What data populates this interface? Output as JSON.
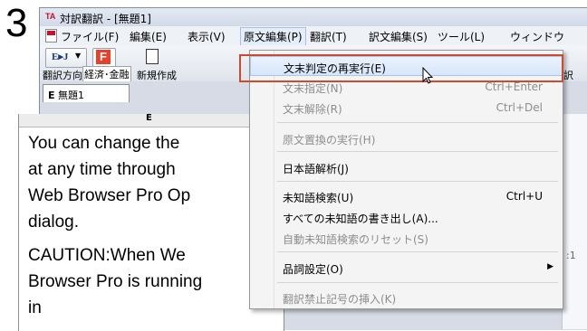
{
  "step_number": "3",
  "window": {
    "title": "対訳翻訳 - [無題1]",
    "app_icon": "TA"
  },
  "menubar": {
    "items": [
      "ファイル(F)",
      "編集(E)",
      "表示(V)",
      "原文編集(P)",
      "翻訳(T)",
      "訳文編集(S)",
      "ツール(L)",
      "ウィンドウ"
    ],
    "active": "原文編集(P)"
  },
  "toolbar": {
    "direction_icon_text": "E▸J",
    "direction_label": "翻訳方向",
    "field_icon_text": "F",
    "field_label": "経済･金融",
    "new_label": "新規作成",
    "right_label": "訳"
  },
  "tab": {
    "label": "無題1",
    "prefix": "E"
  },
  "panel": {
    "header": "E",
    "paragraph1": [
      "You can change the",
      "at any time through",
      "Web Browser Pro Op",
      "dialog."
    ],
    "paragraph2": [
      "CAUTION:When We",
      "Browser Pro is running in"
    ]
  },
  "right_marker": ":1",
  "dropdown": {
    "items": [
      {
        "label": "文末判定の再実行(E)",
        "shortcut": "",
        "disabled": false,
        "highlighted": true
      },
      {
        "label": "文末指定(N)",
        "shortcut": "Ctrl+Enter",
        "disabled": true
      },
      {
        "label": "文末解除(R)",
        "shortcut": "Ctrl+Del",
        "disabled": true
      },
      {
        "label": "原文置換の実行(H)",
        "shortcut": "",
        "disabled": true
      },
      {
        "label": "日本語解析(J)",
        "shortcut": "",
        "disabled": false
      },
      {
        "label": "未知語検索(U)",
        "shortcut": "Ctrl+U",
        "disabled": false
      },
      {
        "label": "すべての未知語の書き出し(A)...",
        "shortcut": "",
        "disabled": false
      },
      {
        "label": "自動未知語検索のリセット(S)",
        "shortcut": "",
        "disabled": true
      },
      {
        "label": "品詞設定(O)",
        "shortcut": "",
        "disabled": false,
        "submenu": true
      },
      {
        "label": "翻訳禁止記号の挿入(K)",
        "shortcut": "",
        "disabled": true
      }
    ]
  },
  "colors": {
    "highlight_box": "#d0492c",
    "menu_hover": "#d7e6fa",
    "accent_red": "#c8102e"
  }
}
